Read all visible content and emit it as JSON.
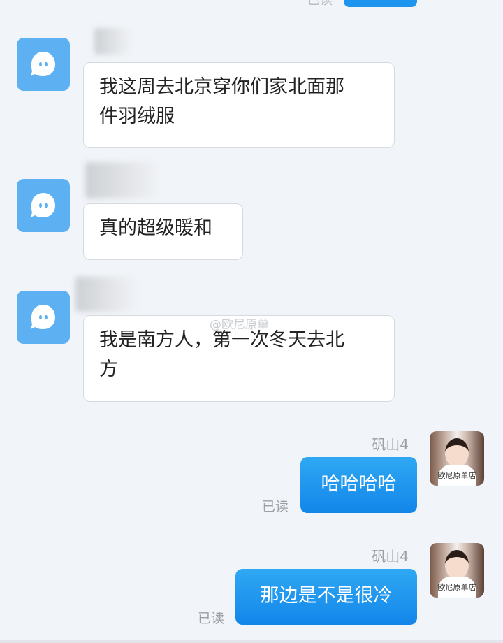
{
  "top_partial": {
    "read_label": "已读"
  },
  "incoming": [
    {
      "text": "我这周去北京穿你们家北面那\n件羽绒服"
    },
    {
      "text": "真的超级暖和"
    },
    {
      "text": "我是南方人，第一次冬天去北\n方"
    }
  ],
  "outgoing": [
    {
      "sender": "矾山4",
      "text": "哈哈哈哈",
      "status": "已读",
      "avatar_caption": "欧尼原单店"
    },
    {
      "sender": "矾山4",
      "text": "那边是不是很冷",
      "status": "已读",
      "avatar_caption": "欧尼原单店"
    }
  ],
  "watermark": "@欧尼原单",
  "icons": {
    "incoming_avatar": "chat-bubble-face-icon"
  },
  "colors": {
    "accent": "#1a93ee",
    "avatar_blue": "#5db0f2",
    "background": "#f1f4f8"
  }
}
